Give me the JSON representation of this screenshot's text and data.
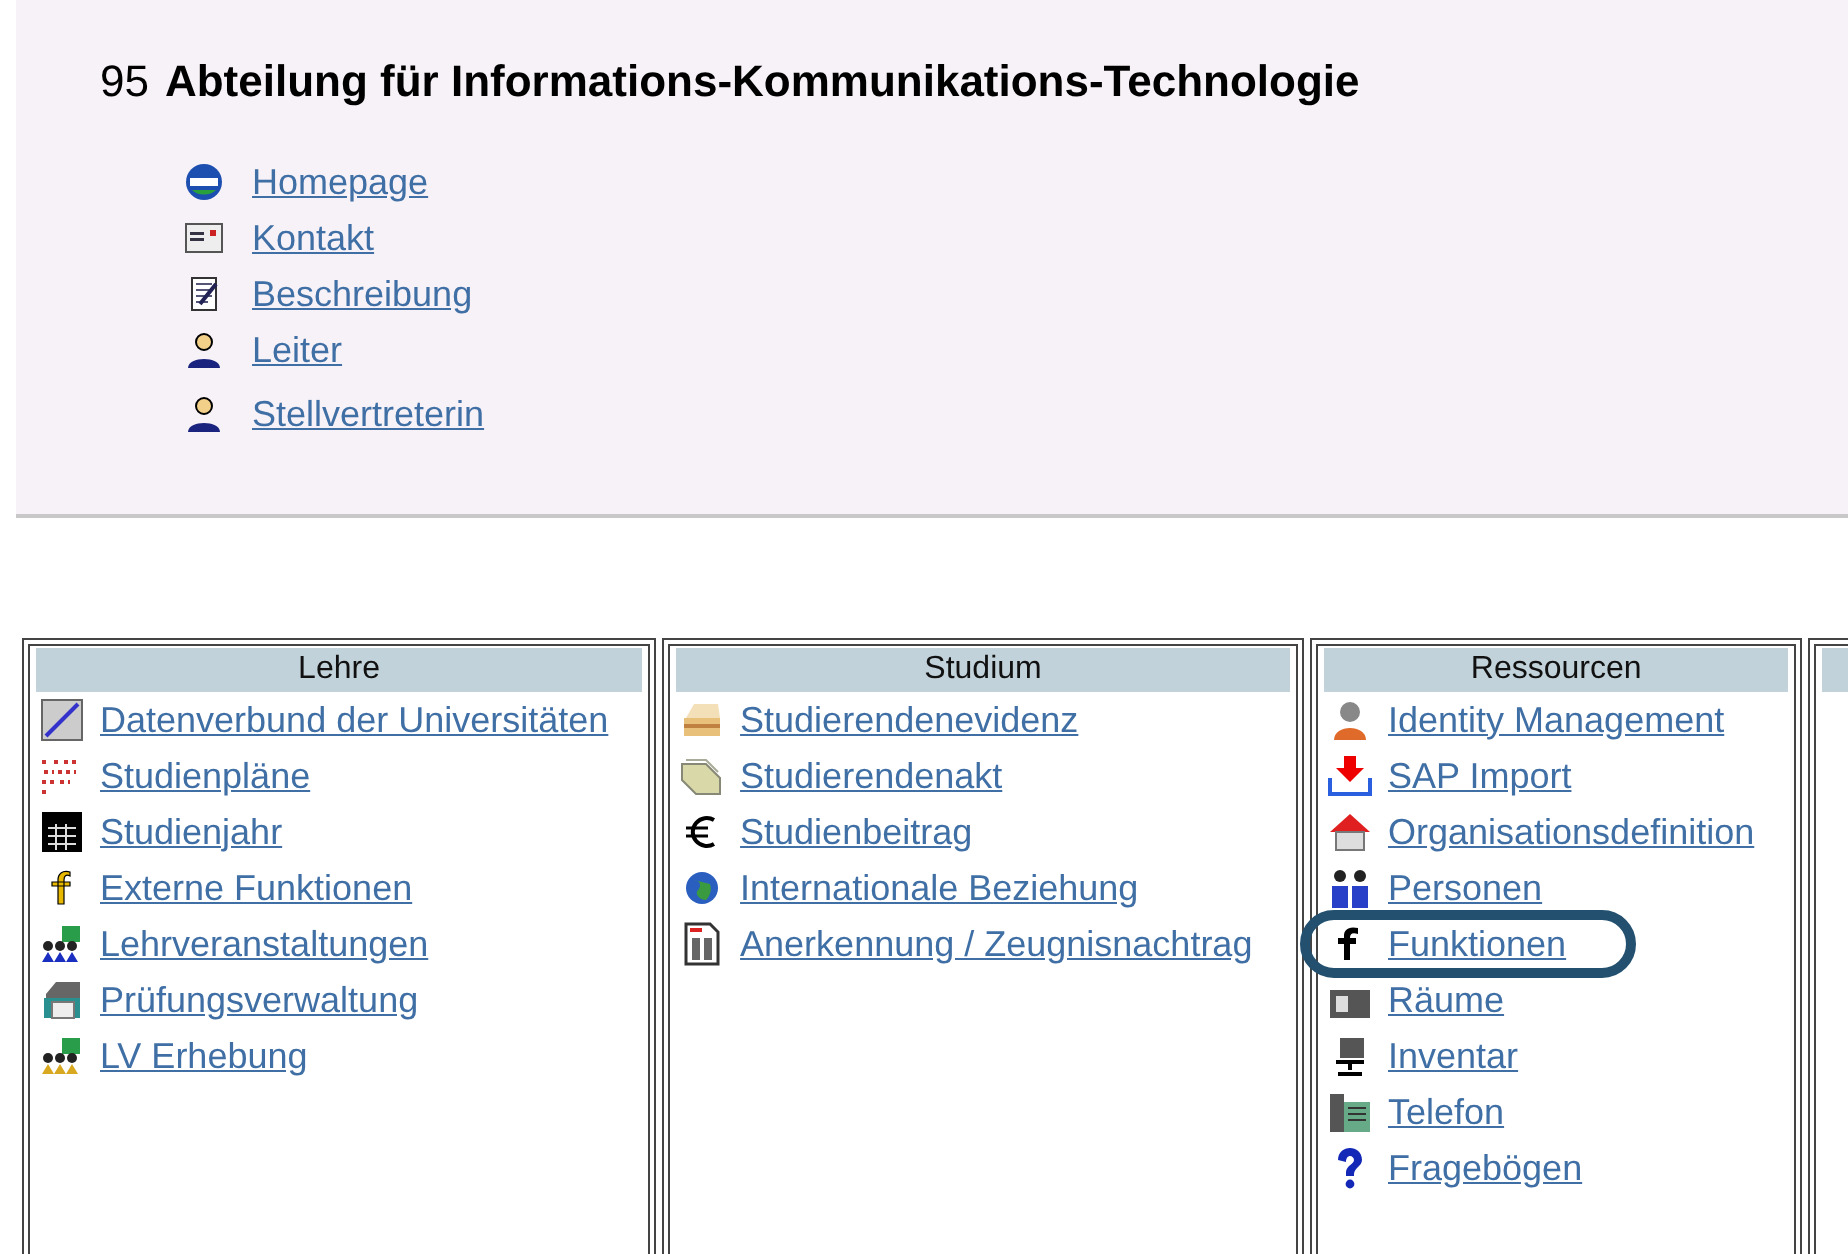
{
  "header": {
    "number": "95",
    "title": "Abteilung für Informations-Kommunikations-Technologie",
    "links": [
      {
        "label": "Homepage"
      },
      {
        "label": "Kontakt"
      },
      {
        "label": "Beschreibung"
      },
      {
        "label": "Leiter"
      },
      {
        "label": "Stellvertreterin"
      }
    ]
  },
  "columns": [
    {
      "title": "Lehre",
      "items": [
        {
          "label": "Datenverbund der Universitäten",
          "highlighted": false
        },
        {
          "label": "Studienpläne",
          "highlighted": false
        },
        {
          "label": "Studienjahr",
          "highlighted": false
        },
        {
          "label": "Externe Funktionen",
          "highlighted": false
        },
        {
          "label": "Lehrveranstaltungen",
          "highlighted": false
        },
        {
          "label": "Prüfungsverwaltung",
          "highlighted": false
        },
        {
          "label": "LV Erhebung",
          "highlighted": false
        }
      ]
    },
    {
      "title": "Studium",
      "items": [
        {
          "label": "Studierendenevidenz",
          "highlighted": false
        },
        {
          "label": "Studierendenakt",
          "highlighted": false
        },
        {
          "label": "Studienbeitrag",
          "highlighted": false
        },
        {
          "label": "Internationale Beziehung",
          "highlighted": false
        },
        {
          "label": "Anerkennung / Zeugnisnachtrag",
          "highlighted": false
        }
      ]
    },
    {
      "title": "Ressourcen",
      "items": [
        {
          "label": "Identity Management",
          "highlighted": false
        },
        {
          "label": "SAP Import",
          "highlighted": false
        },
        {
          "label": "Organisationsdefinition",
          "highlighted": false
        },
        {
          "label": "Personen",
          "highlighted": false
        },
        {
          "label": "Funktionen",
          "highlighted": true
        },
        {
          "label": "Räume",
          "highlighted": false
        },
        {
          "label": "Inventar",
          "highlighted": false
        },
        {
          "label": "Telefon",
          "highlighted": false
        },
        {
          "label": "Fragebögen",
          "highlighted": false
        }
      ]
    }
  ]
}
